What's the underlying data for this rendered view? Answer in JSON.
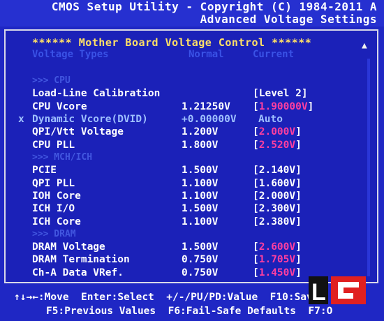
{
  "title": {
    "line1": "CMOS Setup Utility - Copyright (C) 1984-2011 A",
    "line2": "Advanced Voltage Settings"
  },
  "panel": {
    "heading": "****** Mother Board Voltage Control ******",
    "col_name": "Voltage Types",
    "col_normal": "Normal",
    "col_current": "Current",
    "scroll_marker": "▲"
  },
  "rows": [
    {
      "section": ">>> CPU"
    },
    {
      "label": "Load-Line Calibration",
      "normal": "",
      "current": "Level 2",
      "warn": false
    },
    {
      "label": "CPU Vcore",
      "normal": "1.21250V",
      "current": "1.90000V",
      "warn": true
    },
    {
      "label": "Dynamic Vcore(DVID)",
      "normal": "+0.00000V",
      "current": "Auto",
      "dynamic": true,
      "marker": "x"
    },
    {
      "label": "QPI/Vtt Voltage",
      "normal": "1.200V",
      "current": "2.000V",
      "warn": true
    },
    {
      "label": "CPU PLL",
      "normal": "1.800V",
      "current": "2.520V",
      "warn": true
    },
    {
      "section": ">>> MCH/ICH"
    },
    {
      "label": "PCIE",
      "normal": "1.500V",
      "current": "2.140V",
      "warn": false
    },
    {
      "label": "QPI PLL",
      "normal": "1.100V",
      "current": "1.600V",
      "warn": false
    },
    {
      "label": "IOH Core",
      "normal": "1.100V",
      "current": "2.000V",
      "warn": false
    },
    {
      "label": "ICH I/O",
      "normal": "1.500V",
      "current": "2.300V",
      "warn": false
    },
    {
      "label": "ICH Core",
      "normal": "1.100V",
      "current": "2.380V",
      "warn": false
    },
    {
      "section": ">>> DRAM"
    },
    {
      "label": "DRAM Voltage",
      "normal": "1.500V",
      "current": "2.600V",
      "warn": true
    },
    {
      "label": "DRAM Termination",
      "normal": "0.750V",
      "current": "1.705V",
      "warn": true
    },
    {
      "label": "Ch-A Data VRef.",
      "normal": "0.750V",
      "current": "1.450V",
      "warn": true
    }
  ],
  "footer": {
    "line1": "↑↓→←:Move  Enter:Select  +/-/PU/PD:Value  F10:Save",
    "line2": "F5:Previous Values  F6:Fail-Safe Defaults  F7:O"
  },
  "logo": {
    "text": "L",
    "colors": {
      "red": "#e02020",
      "black": "#111111",
      "white": "#ffffff"
    }
  }
}
